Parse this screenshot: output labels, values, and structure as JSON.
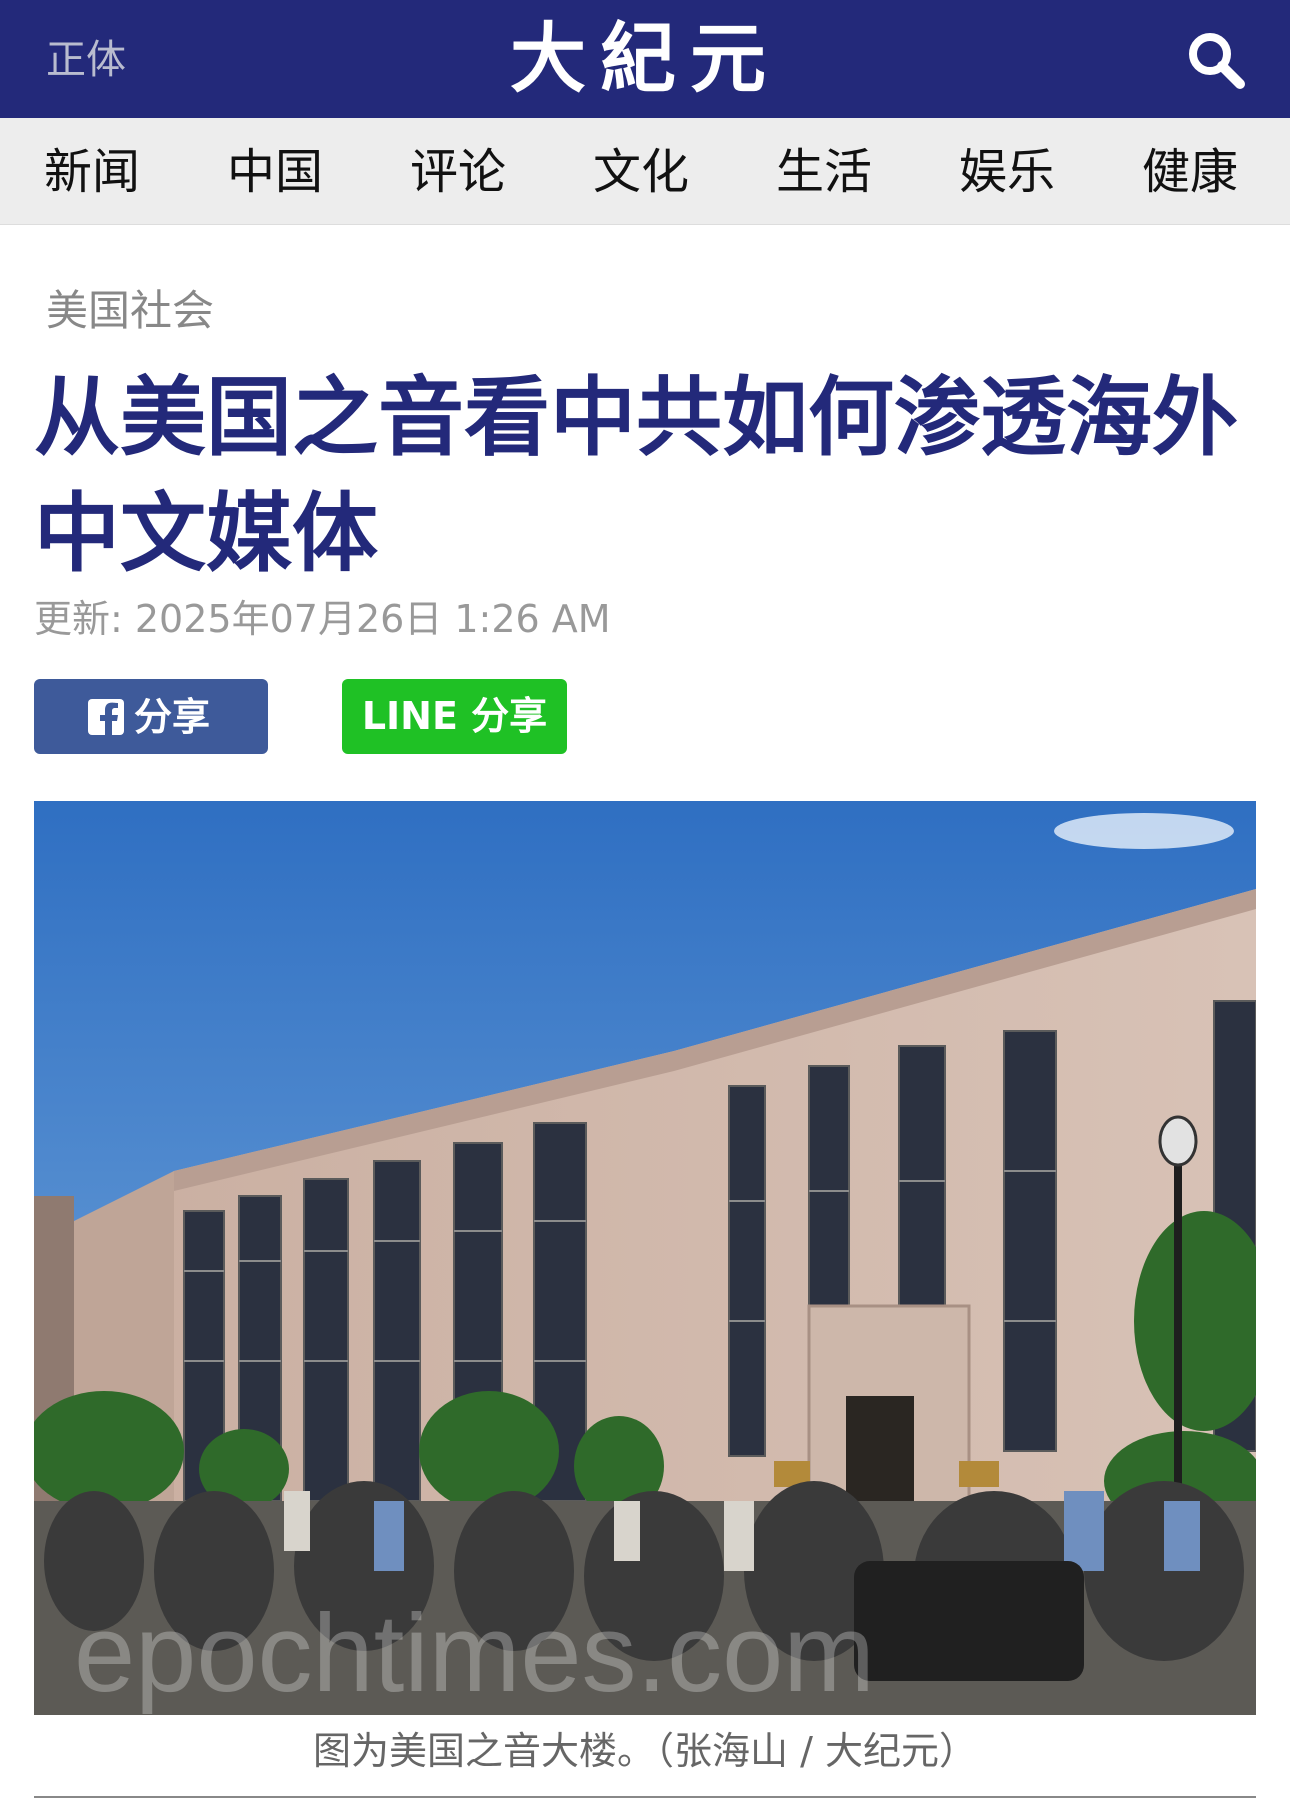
{
  "header": {
    "lang_switch": "正体",
    "logo": "大紀元",
    "search_icon": "search-icon"
  },
  "nav": {
    "items": [
      "新闻",
      "中国",
      "评论",
      "文化",
      "生活",
      "娱乐",
      "健康"
    ]
  },
  "article": {
    "category": "美国社会",
    "title": "从美国之音看中共如何渗透海外中文媒体",
    "updated": "更新: 2025年07月26日 1:26 AM",
    "share_facebook": "分享",
    "share_line": "LINE 分享",
    "image_watermark": "epochtimes.com",
    "image_caption": "图为美国之音大楼。（张海山 / 大纪元）"
  },
  "colors": {
    "brand": "#23297a",
    "nav_bg": "#ededed",
    "facebook": "#3e5a9a",
    "line": "#1fc125"
  }
}
